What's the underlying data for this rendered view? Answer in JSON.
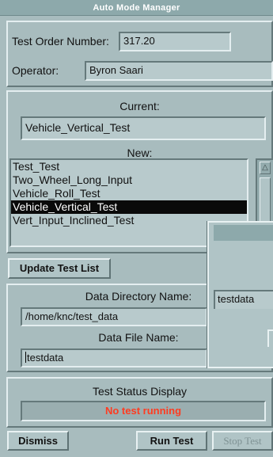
{
  "window": {
    "title": "Auto Mode Manager"
  },
  "order": {
    "test_order_label": "Test Order Number:",
    "test_order_value": "317.20",
    "operator_label": "Operator:",
    "operator_value": "Byron Saari"
  },
  "tests": {
    "current_label": "Current:",
    "current_value": "Vehicle_Vertical_Test",
    "new_label": "New:",
    "list": [
      "Test_Test",
      "Two_Wheel_Long_Input",
      "Vehicle_Roll_Test",
      "Vehicle_Vertical_Test",
      "Vert_Input_Inclined_Test"
    ],
    "selected_index": 3,
    "update_button": "Update Test List"
  },
  "data": {
    "directory_label": "Data Directory Name:",
    "directory_value": "/home/knc/test_data",
    "file_label": "Data File Name:",
    "file_value": "testdata"
  },
  "status": {
    "label": "Test Status Display",
    "value": "No test running",
    "value_color": "#ff3b20"
  },
  "buttons": {
    "dismiss": "Dismiss",
    "run": "Run Test",
    "stop": "Stop Test"
  },
  "dialog": {
    "field_value": "testdata"
  }
}
